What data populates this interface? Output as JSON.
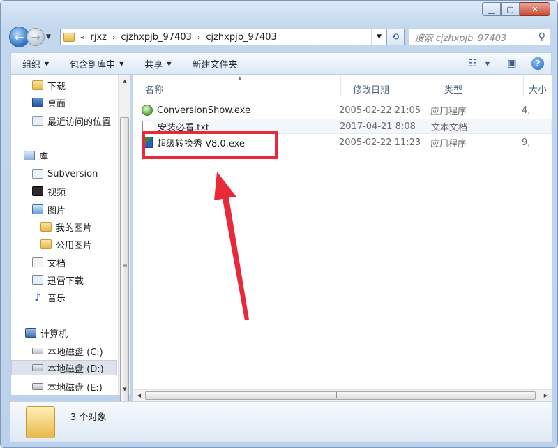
{
  "address": {
    "crumbs": [
      "rjxz",
      "cjzhxpjb_97403",
      "cjzhxpjb_97403"
    ],
    "overflow": "«"
  },
  "search": {
    "placeholder": "搜索 cjzhxpjb_97403"
  },
  "toolbar": {
    "organize": "组织",
    "include_library": "包含到库中",
    "share": "共享",
    "new_folder": "新建文件夹"
  },
  "nav": {
    "items": [
      {
        "label": "下载"
      },
      {
        "label": "桌面"
      },
      {
        "label": "最近访问的位置"
      },
      {
        "label": "库"
      },
      {
        "label": "Subversion"
      },
      {
        "label": "视频"
      },
      {
        "label": "图片"
      },
      {
        "label": "我的图片"
      },
      {
        "label": "公用图片"
      },
      {
        "label": "文档"
      },
      {
        "label": "迅雷下载"
      },
      {
        "label": "音乐"
      },
      {
        "label": "计算机"
      },
      {
        "label": "本地磁盘 (C:)"
      },
      {
        "label": "本地磁盘 (D:)"
      },
      {
        "label": "本地磁盘 (E:)"
      }
    ]
  },
  "columns": {
    "name": "名称",
    "date": "修改日期",
    "type": "类型",
    "size": "大小"
  },
  "files": [
    {
      "name": "ConversionShow.exe",
      "date": "2005-02-22 21:05",
      "type": "应用程序",
      "size": "4,"
    },
    {
      "name": "安装必看.txt",
      "date": "2017-04-21 8:08",
      "type": "文本文档",
      "size": ""
    },
    {
      "name": "超级转换秀 V8.0.exe",
      "date": "2005-02-22 11:23",
      "type": "应用程序",
      "size": "9,"
    }
  ],
  "status": {
    "count": "3 个对象"
  },
  "colors": {
    "highlight": "#e8293a"
  }
}
